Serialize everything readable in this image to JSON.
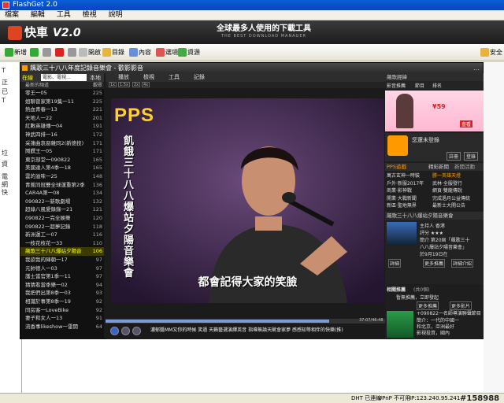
{
  "outer": {
    "title": "FlashGet 2.0",
    "menu": [
      "檔案",
      "編輯",
      "工具",
      "檢視",
      "說明"
    ],
    "logo": "快車",
    "version": "V2.0",
    "slogan": "全球最多人使用的下載工具",
    "slogan_sub": "THE BEST DOWNLOAD MANAGER",
    "toolbar": [
      {
        "label": "新增",
        "icon": "plus-icon",
        "color": "#3a3"
      },
      {
        "label": "",
        "icon": "play-icon",
        "color": "#3a3"
      },
      {
        "label": "",
        "icon": "stop-icon",
        "color": "#999"
      },
      {
        "label": "",
        "icon": "delete-icon",
        "color": "#d22"
      },
      {
        "label": "",
        "icon": "up-icon",
        "color": "#999"
      },
      {
        "label": "開啟",
        "icon": "open-icon",
        "color": "#bbb"
      },
      {
        "label": "目錄",
        "icon": "folder-icon",
        "color": "#e6b73a"
      },
      {
        "label": "內容",
        "icon": "properties-icon",
        "color": "#6b8ed8"
      },
      {
        "label": "選項",
        "icon": "options-icon",
        "color": "#d55"
      },
      {
        "label": "資源",
        "icon": "resources-icon",
        "color": "#4a4"
      },
      {
        "label": "安全",
        "icon": "security-icon",
        "color": "#e9b23a"
      }
    ],
    "tree": [
      "T",
      "正",
      "已",
      "T",
      "垃",
      "資",
      "電",
      "網",
      "快"
    ],
    "status": [
      "DHT 已連線",
      "UPnP 不可用",
      "IP:123.240.95.241"
    ],
    "watermark": "#158988"
  },
  "pps": {
    "title": "飆歌三十八八年度記錄音樂會 - 歡影影音",
    "title_right": "…",
    "tabs": {
      "online": "在線",
      "local": "本地"
    },
    "search_value": "電影、電視...",
    "list_header": {
      "left": "最新的頻道",
      "right": "觀眾"
    },
    "channels": [
      {
        "name": "零王一05",
        "count": "225"
      },
      {
        "name": "姐聊曾家第19集一11",
        "count": "225"
      },
      {
        "name": "熱血青春一13",
        "count": "221"
      },
      {
        "name": "天地人一22",
        "count": "201"
      },
      {
        "name": "紅數英雄傳一04",
        "count": "191"
      },
      {
        "name": "神武四排一16",
        "count": "172"
      },
      {
        "name": "采蓮曲哀惡雜同2(新德技)",
        "count": "171"
      },
      {
        "name": "鬧饌王一05",
        "count": "171"
      },
      {
        "name": "東京部堂一090822",
        "count": "165"
      },
      {
        "name": "美國達人第4季一18",
        "count": "165"
      },
      {
        "name": "雲的滋味一25",
        "count": "148"
      },
      {
        "name": "青蕉同冠雙全球運重第2季",
        "count": "136"
      },
      {
        "name": "CAR4A第一08",
        "count": "134"
      },
      {
        "name": "090822一新歌劇場",
        "count": "132"
      },
      {
        "name": "超綠八風愛錄錄一21",
        "count": "121"
      },
      {
        "name": "090822一完全娛樂",
        "count": "120"
      },
      {
        "name": "090822一超夢記錄",
        "count": "118"
      },
      {
        "name": "新洲運工一07",
        "count": "116"
      },
      {
        "name": "一枝花枝花一33",
        "count": "110"
      },
      {
        "name": "飆歌三十八八爆站夕陽音",
        "count": "106"
      },
      {
        "name": "我欲我的陣朝一17",
        "count": "97"
      },
      {
        "name": "元帥德人一03",
        "count": "97"
      },
      {
        "name": "護士當官第1季一11",
        "count": "97"
      },
      {
        "name": "猜猜看當季樂一02",
        "count": "94"
      },
      {
        "name": "我把們出第8季一03",
        "count": "93"
      },
      {
        "name": "相識於事第8季一19",
        "count": "92"
      },
      {
        "name": "同房客一LoveBike",
        "count": "92"
      },
      {
        "name": "妻子和女人一13",
        "count": "91"
      },
      {
        "name": "流香事likeshow一雷開",
        "count": "64"
      }
    ],
    "video_bar": [
      "播放",
      "檢視",
      "工具",
      "記錄"
    ],
    "subbar": [
      "1x",
      "1.5x",
      "2x",
      "4x"
    ],
    "video_logo": "PPS",
    "video_vertical_text": "飢餓三十八八爆站夕陽音樂會",
    "subtitle": "都會記得大家的笑臉",
    "time": "37:07/46:48",
    "progress": 0.8,
    "ticker": "濃郁醬MM又你的時候 笑過  天籟藝選演繹英音 指導無論天賦會家夢  感感知等相伴的快樂(推)",
    "side": {
      "head_top": "飆歌經緯",
      "tabs": [
        "影音推薦",
        "節目",
        "排名"
      ],
      "ad_price": "¥59",
      "ad_btn": "查看",
      "login_text": "您還未登錄",
      "login_buttons": [
        "註冊",
        "登錄"
      ],
      "games_head": "PPS遊戲",
      "games_tab": "精彩新聞",
      "games_more": "新開活動",
      "game_rows": [
        [
          "萬古玄神一時裝",
          "勝一英雄天燈"
        ],
        [
          "戶外·新服2017年",
          "武林·全服發行"
        ],
        [
          "商業·影神戰",
          "網頁·雙龍傳說"
        ],
        [
          "開業·大戰新聞",
          "完成過月公益傳統"
        ],
        [
          "新區·聖地無界",
          "最新士大開公告"
        ]
      ],
      "info_head": "飆歌三十八八爆站夕陽音樂會",
      "info_lines": [
        "主持人  香港",
        "評分  ★★★",
        "簡介  第20屆「飆歌三十",
        "八八爆站夕陽音樂會」",
        "於9月19日在"
      ],
      "info_btns": [
        "詳細",
        "更多推薦",
        "詳細介紹"
      ],
      "related_head": "相關推薦",
      "related_sub": "(共0個)",
      "related_line": "暫無推薦，立即發起",
      "related_btns": [
        "更多推薦",
        "更多影片"
      ],
      "promo_title": "+090822一名師導演聯聲節目",
      "promo_lines": [
        "簡介：一代的中國一",
        "和北京，亞洲最好",
        "影視投資，國內",
        "在日本，新一代一"
      ]
    }
  }
}
